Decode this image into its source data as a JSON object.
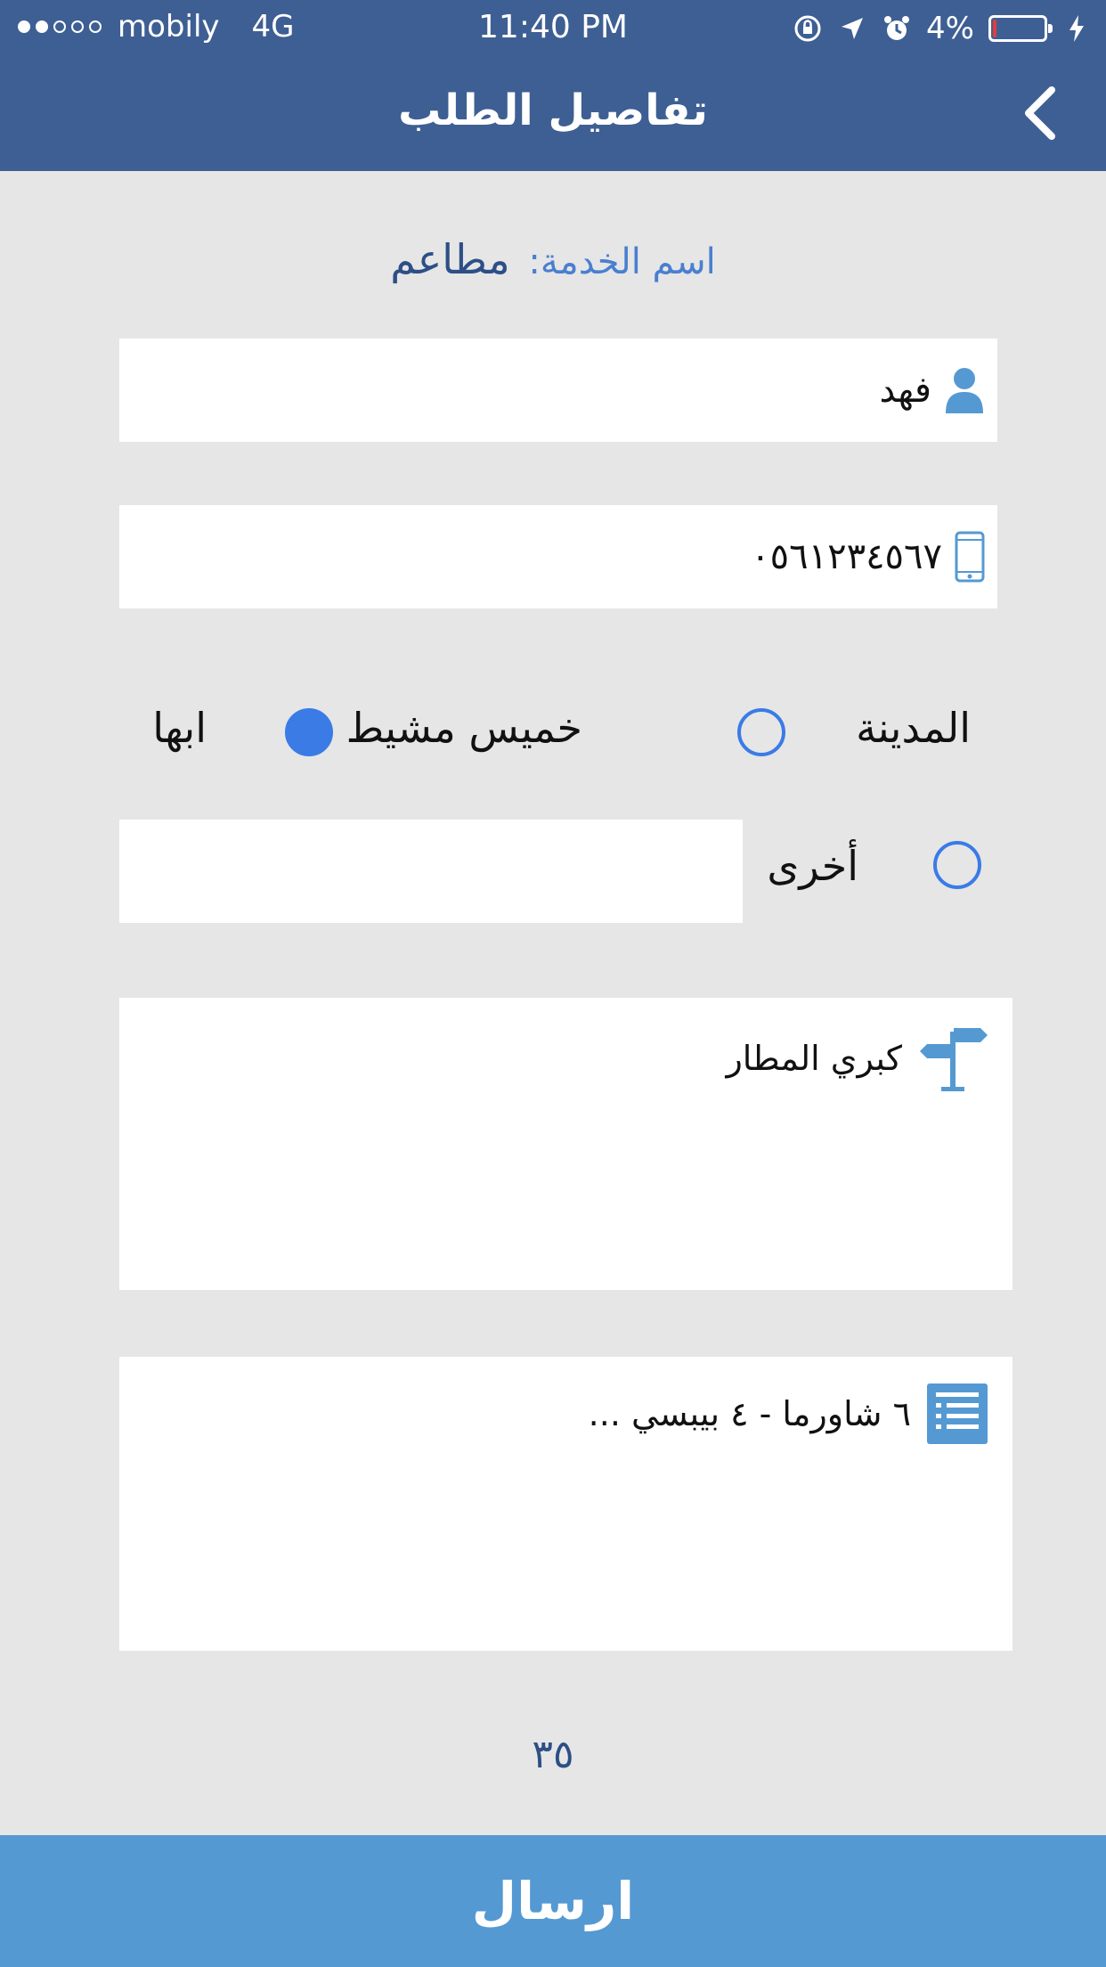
{
  "status_bar": {
    "carrier": "mobily",
    "network": "4G",
    "time": "11:40 PM",
    "battery_percent": "4%",
    "battery_level": 0.04,
    "signal_dots_filled": 2,
    "signal_dots_total": 5
  },
  "header": {
    "title": "تفاصيل الطلب",
    "back_icon": "chevron-left-icon"
  },
  "service": {
    "label": "اسم الخدمة:",
    "value": "مطاعم"
  },
  "form": {
    "name_value": "فهد",
    "phone_value": "٠٥٦١٢٣٤٥٦٧",
    "city_label": "المدينة",
    "cities": [
      {
        "label": "خميس مشيط",
        "selected": false
      },
      {
        "label": "ابها",
        "selected": true
      }
    ],
    "other_label": "أخرى",
    "other_value": "",
    "address_value": "كبري المطار",
    "order_value": "٦ شاورما - ٤ بيبسي ..."
  },
  "total": "٣٥",
  "send_button": "ارسال",
  "colors": {
    "header": "#3e5f93",
    "accent": "#3a7be6",
    "button": "#5599d3",
    "background": "#e6e6e6"
  }
}
